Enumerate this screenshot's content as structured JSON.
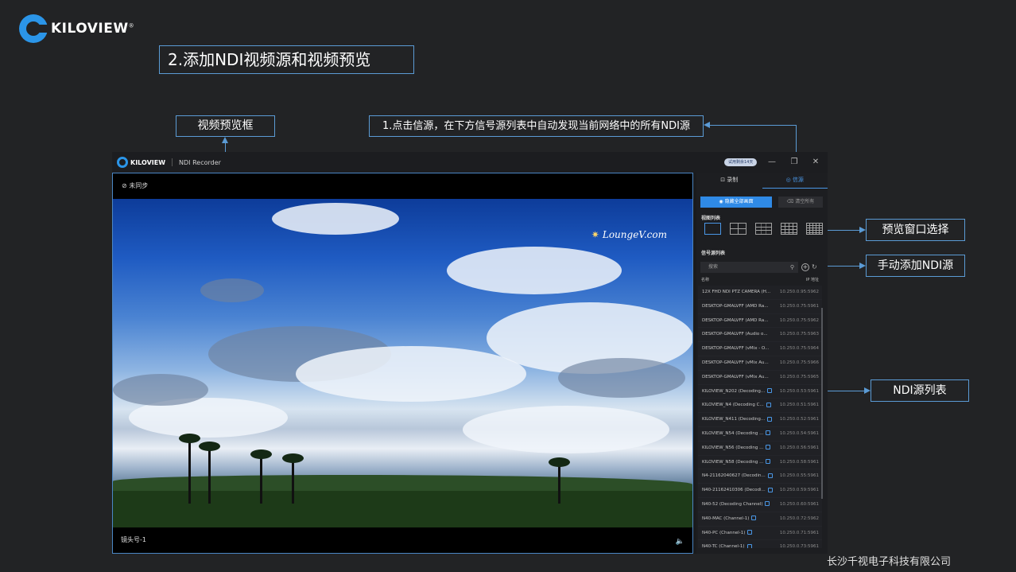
{
  "brand": {
    "name": "KILOVIEW",
    "mark": "®"
  },
  "step_title": "2.添加NDI视频源和视频预览",
  "callouts": {
    "preview": "视频预览框",
    "source": "1.点击信源，在下方信号源列表中自动发现当前网络中的所有NDI源",
    "window": "预览窗口选择",
    "manual": "手动添加NDI源",
    "list": "NDI源列表"
  },
  "app": {
    "logo_text": "KILOVIEW",
    "title": "NDI Recorder",
    "trial_badge": "试用剩余14天",
    "window_controls": {
      "minimize": "—",
      "restore": "❐",
      "close": "✕"
    },
    "preview": {
      "sync_status": "⊘ 未同步",
      "watermark": "LoungeV.com",
      "channel_label": "镜头号-1",
      "volume_icon": "🔈"
    },
    "side": {
      "tabs": [
        {
          "icon": "⊡",
          "label": "录制"
        },
        {
          "icon": "◎",
          "label": "信源"
        }
      ],
      "hide_all_button": "◉ 隐藏全部画面",
      "clear_all_button": "⌫ 清空所有",
      "view_list_label": "视图列表",
      "source_list_label": "信号源列表",
      "search_placeholder": "搜索",
      "search_icon": "⚲",
      "add_icon": "+",
      "refresh_icon": "↻",
      "col_name": "名称",
      "col_ip": "IP 地址",
      "sources": [
        {
          "name": "12X FHD NDI PTZ CAMERA (H...",
          "ip": "10.250.0.95:5962",
          "badge": false
        },
        {
          "name": "DESKTOP-GMALVFF (AMD Ra...",
          "ip": "10.250.0.75:5961",
          "badge": false
        },
        {
          "name": "DESKTOP-GMALVFF (AMD Ra...",
          "ip": "10.250.0.75:5962",
          "badge": false
        },
        {
          "name": "DESKTOP-GMALVFF (Audio o...",
          "ip": "10.250.0.75:5963",
          "badge": false
        },
        {
          "name": "DESKTOP-GMALVFF (vMix - O...",
          "ip": "10.250.0.75:5964",
          "badge": false
        },
        {
          "name": "DESKTOP-GMALVFF (vMix Au...",
          "ip": "10.250.0.75:5966",
          "badge": false
        },
        {
          "name": "DESKTOP-GMALVFF (vMix Au...",
          "ip": "10.250.0.75:5965",
          "badge": false
        },
        {
          "name": "KILOVIEW_N202 (Decoding...",
          "ip": "10.250.0.53:5961",
          "badge": true
        },
        {
          "name": "KILOVIEW_N4 (Decoding C...",
          "ip": "10.250.0.51:5961",
          "badge": true
        },
        {
          "name": "KILOVIEW_N411 (Decoding...",
          "ip": "10.250.0.52:5961",
          "badge": true
        },
        {
          "name": "KILOVIEW_N54 (Decoding ...",
          "ip": "10.250.0.54:5961",
          "badge": true
        },
        {
          "name": "KILOVIEW_N56 (Decoding ...",
          "ip": "10.250.0.56:5961",
          "badge": true
        },
        {
          "name": "KILOVIEW_N58 (Decoding ...",
          "ip": "10.250.0.58:5961",
          "badge": true
        },
        {
          "name": "N4-21162040627 (Decodin...",
          "ip": "10.250.0.55:5961",
          "badge": true
        },
        {
          "name": "N40-21162410306 (Decodi...",
          "ip": "10.250.0.59:5961",
          "badge": true
        },
        {
          "name": "N40-52 (Decoding Channel)",
          "ip": "10.250.0.60:5961",
          "badge": true
        },
        {
          "name": "N40-MAC (Channel-1)",
          "ip": "10.250.0.72:5962",
          "badge": true
        },
        {
          "name": "N40-PC (Channel-1)",
          "ip": "10.250.0.71:5961",
          "badge": true
        },
        {
          "name": "N40-TC (Channel-1)",
          "ip": "10.250.0.73:5961",
          "badge": true
        }
      ]
    }
  },
  "company": "长沙千视电子科技有限公司",
  "colors": {
    "accent": "#5b9bd5",
    "primary_button": "#2f8ae6",
    "brand_blue": "#2b95e8"
  }
}
